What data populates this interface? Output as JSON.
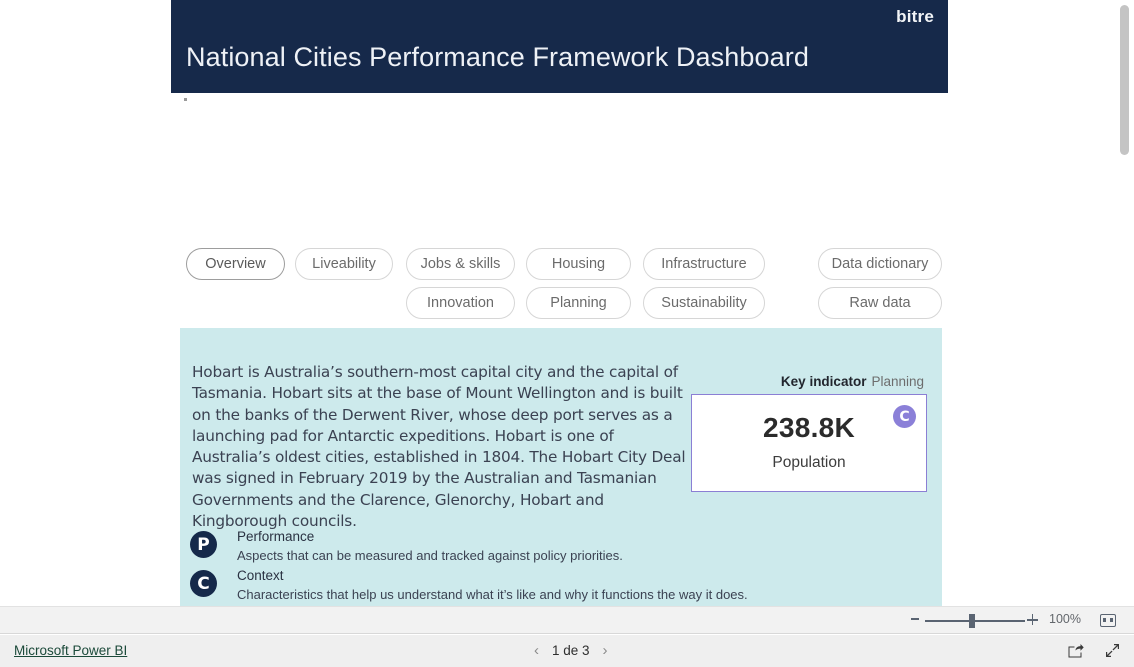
{
  "header": {
    "logo": "bitre",
    "title": "National Cities Performance Framework Dashboard"
  },
  "nav": {
    "row1": [
      {
        "label": "Overview",
        "selected": true
      },
      {
        "label": "Liveability",
        "selected": false
      },
      {
        "label": "Jobs & skills",
        "selected": false
      },
      {
        "label": "Housing",
        "selected": false
      },
      {
        "label": "Infrastructure",
        "selected": false
      },
      {
        "label": "Data dictionary",
        "selected": false
      }
    ],
    "row2": [
      {
        "label": "Innovation",
        "selected": false
      },
      {
        "label": "Planning",
        "selected": false
      },
      {
        "label": "Sustainability",
        "selected": false
      },
      {
        "label": "Raw data",
        "selected": false
      }
    ]
  },
  "panel": {
    "description": "Hobart is Australia’s southern-most capital city and the capital of Tasmania. Hobart sits at the base of Mount Wellington and is built on the banks of the Derwent River, whose deep port serves as a launching pad for Antarctic expeditions. Hobart is one of Australia’s oldest cities, established in 1804. The Hobart City Deal was signed in February 2019 by the Australian and Tasmanian Governments and the Clarence, Glenorchy, Hobart and Kingborough councils.",
    "key_indicator": {
      "label_bold": "Key indicator",
      "label_rest": "Planning",
      "value": "238.8K",
      "name": "Population",
      "badge": "C",
      "badge_color": "#8b80d8",
      "border_color": "#8b7fd4"
    },
    "legend": [
      {
        "badge": "P",
        "title": "Performance",
        "description": "Aspects that can be measured and tracked against policy priorities."
      },
      {
        "badge": "C",
        "title": "Context",
        "description": "Characteristics that help us understand what it’s like and why it functions the way it does."
      }
    ],
    "background_color": "#cdeaec"
  },
  "zoombar": {
    "minus_label": "-",
    "plus_label": "+",
    "percent": "100%",
    "fit_icon": "fit-to-page-icon"
  },
  "statusbar": {
    "powerbi_link": "Microsoft Power BI",
    "prev_arrow": "‹",
    "next_arrow": "›",
    "page_text": "1 de 3",
    "share_icon": "share-icon",
    "fullscreen_icon": "fullscreen-icon"
  }
}
